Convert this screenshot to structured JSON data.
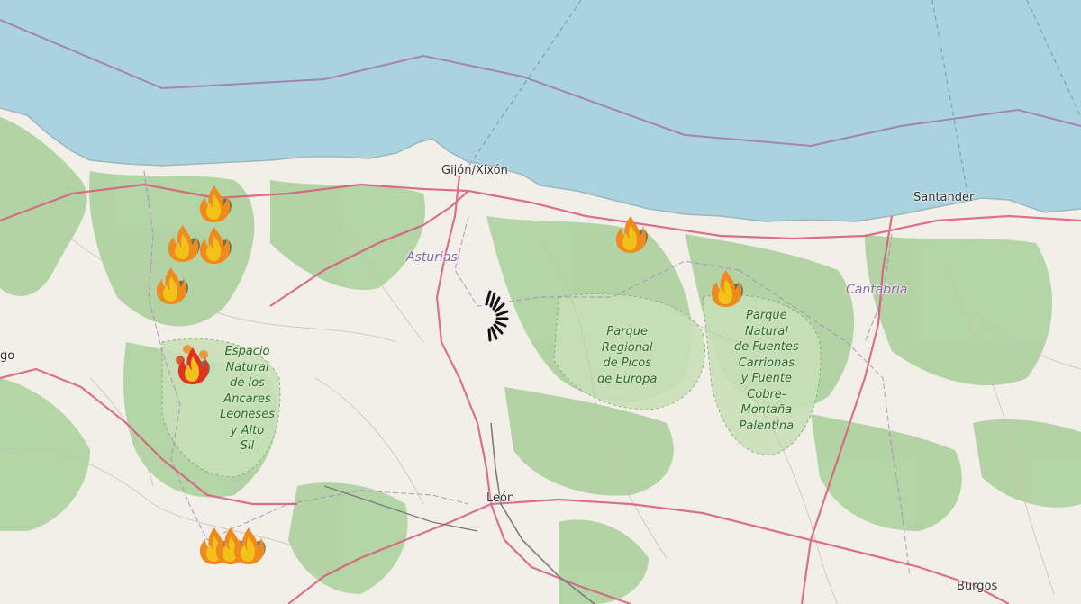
{
  "map": {
    "labels": {
      "gijon": "Gijón/Xixón",
      "santander": "Santander",
      "asturias": "Asturias",
      "cantabria": "Cantabria",
      "leon": "León",
      "burgos": "Burgos",
      "lugo_partial": "go"
    },
    "parks": {
      "picos": "Parque\nRegional\nde Picos\nde Europa",
      "fuentes_carrionas": "Parque\nNatural\nde Fuentes\nCarrionas\ny Fuente\nCobre-\nMontaña\nPalentina",
      "ancares": "Espacio\nNatural\nde los\nAncares\nLeoneses\ny Alto\nSil"
    },
    "colors": {
      "sea": "#aad3df",
      "land": "#f2efe9",
      "forest": "#add19e",
      "park": "#c8e0b8",
      "road_primary": "#d85a7a",
      "maritime_border": "#a483b8",
      "fire_yellow": "#f2c21a",
      "fire_orange": "#f08a1c",
      "fire_red": "#e0341e"
    },
    "markers": [
      {
        "name": "fire-marker",
        "icon": "fire-icon",
        "status": "active"
      },
      {
        "name": "fire-marker",
        "icon": "fire-icon",
        "status": "active"
      },
      {
        "name": "fire-marker",
        "icon": "fire-icon",
        "status": "active"
      },
      {
        "name": "fire-marker",
        "icon": "fire-icon",
        "status": "active"
      },
      {
        "name": "fire-marker",
        "icon": "fire-icon",
        "status": "active"
      },
      {
        "name": "fire-marker",
        "icon": "fire-icon",
        "status": "active"
      },
      {
        "name": "fire-marker",
        "icon": "fire-icon",
        "status": "critical"
      },
      {
        "name": "fire-marker",
        "icon": "fire-icon",
        "status": "active"
      },
      {
        "name": "fire-marker",
        "icon": "fire-icon",
        "status": "active"
      },
      {
        "name": "fire-marker",
        "icon": "fire-icon",
        "status": "active"
      }
    ],
    "loading_icon": "spinner-icon"
  }
}
